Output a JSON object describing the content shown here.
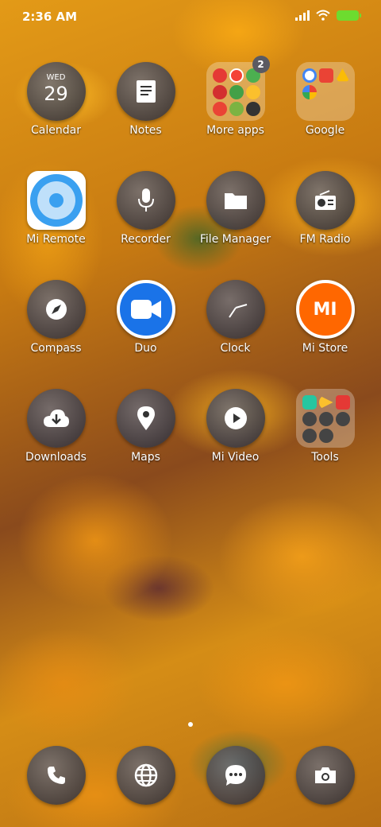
{
  "status": {
    "time": "2:36 AM"
  },
  "apps": [
    {
      "label": "Calendar",
      "icon": "calendar-icon",
      "day": "WED",
      "date": "29"
    },
    {
      "label": "Notes",
      "icon": "notes-icon"
    },
    {
      "label": "More apps",
      "icon": "folder-icon",
      "badge": "2"
    },
    {
      "label": "Google",
      "icon": "folder-icon"
    },
    {
      "label": "Mi Remote",
      "icon": "remote-icon"
    },
    {
      "label": "Recorder",
      "icon": "microphone-icon"
    },
    {
      "label": "File Manager",
      "icon": "folder-file-icon"
    },
    {
      "label": "FM Radio",
      "icon": "radio-icon"
    },
    {
      "label": "Compass",
      "icon": "compass-icon"
    },
    {
      "label": "Duo",
      "icon": "video-camera-icon"
    },
    {
      "label": "Clock",
      "icon": "clock-icon"
    },
    {
      "label": "Mi Store",
      "icon": "mi-logo-icon",
      "logo_text": "MI"
    },
    {
      "label": "Downloads",
      "icon": "download-cloud-icon"
    },
    {
      "label": "Maps",
      "icon": "map-pin-icon"
    },
    {
      "label": "Mi Video",
      "icon": "play-icon"
    },
    {
      "label": "Tools",
      "icon": "folder-icon"
    }
  ],
  "dock": [
    {
      "icon": "phone-icon"
    },
    {
      "icon": "globe-icon"
    },
    {
      "icon": "chat-icon"
    },
    {
      "icon": "camera-icon"
    }
  ],
  "colors": {
    "duo_blue": "#1a73e8",
    "mi_orange": "#ff6700",
    "remote_blue": "#3aa0f0",
    "battery": "#6ddc2f"
  }
}
